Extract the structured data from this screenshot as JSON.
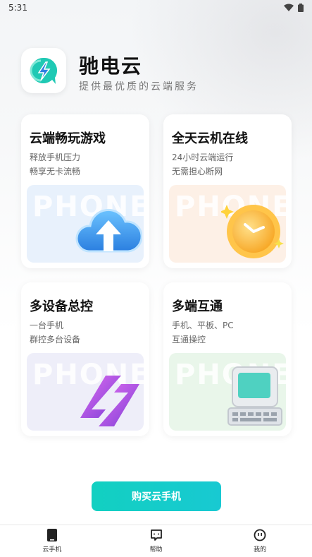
{
  "status_bar": {
    "time": "5:31"
  },
  "header": {
    "app_name": "驰电云",
    "slogan": "提供最优质的云端服务",
    "logo_icon": "lightning-cloud-icon",
    "brand_color": "#12d0c1"
  },
  "cards": [
    {
      "title": "云端畅玩游戏",
      "line1": "释放手机压力",
      "line2": "畅享无卡流畅",
      "watermark": "PHONE",
      "art_icon": "cloud-upload-icon",
      "panel_color": "#e8f1fc"
    },
    {
      "title": "全天云机在线",
      "line1": "24小时云端运行",
      "line2": "无需担心断网",
      "watermark": "PHONE",
      "art_icon": "clock-icon",
      "panel_color": "#fdf0e6"
    },
    {
      "title": "多设备总控",
      "line1": "一台手机",
      "line2": "群控多台设备",
      "watermark": "PHONE",
      "art_icon": "switch-arrows-icon",
      "panel_color": "#eeeef9"
    },
    {
      "title": "多端互通",
      "line1": "手机、平板、PC",
      "line2": "互通操控",
      "watermark": "PHONE",
      "art_icon": "computer-icon",
      "panel_color": "#e9f6ea"
    }
  ],
  "buy_button": {
    "label": "购买云手机"
  },
  "tabbar": {
    "items": [
      {
        "label": "云手机",
        "icon": "phone-icon"
      },
      {
        "label": "帮助",
        "icon": "help-chat-icon"
      },
      {
        "label": "我的",
        "icon": "smiley-icon"
      }
    ]
  }
}
